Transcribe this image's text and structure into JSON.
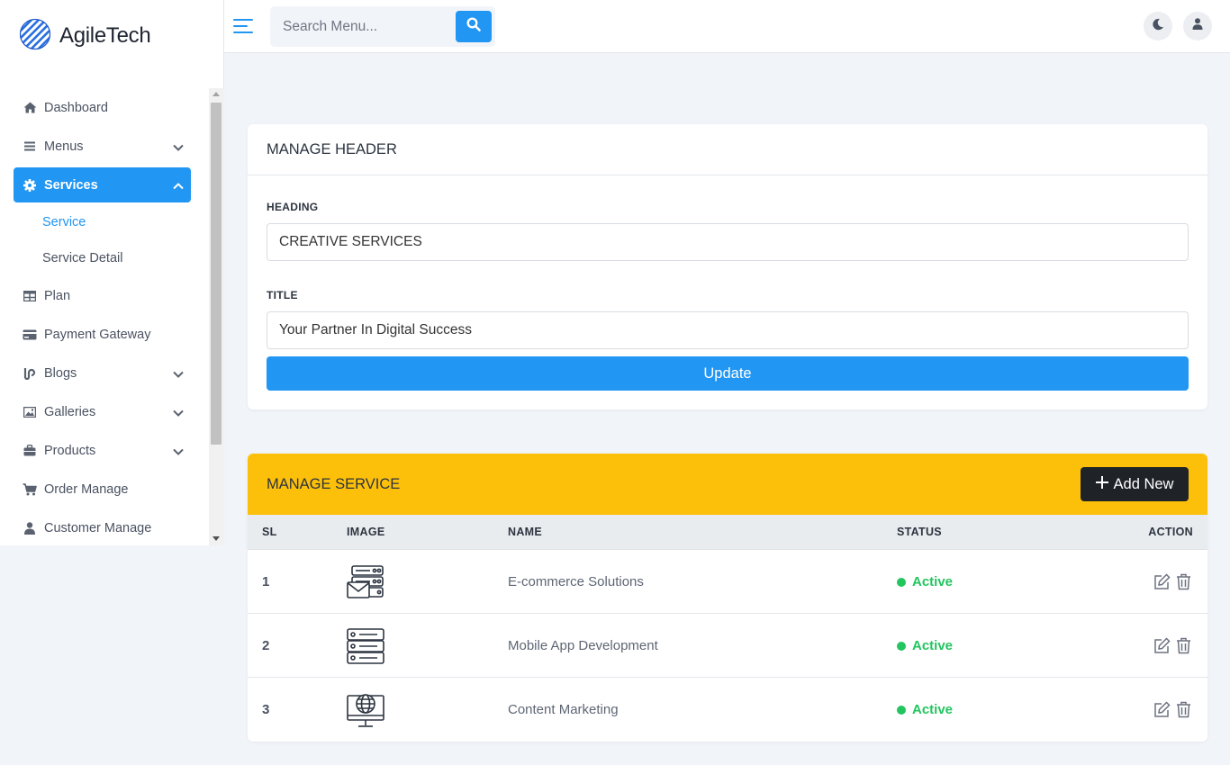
{
  "brand": {
    "name": "AgileTech",
    "logo_icon": "sphere-logo-icon",
    "accent": "#2196f3"
  },
  "sidebar": {
    "items": [
      {
        "label": "Dashboard",
        "icon": "home-icon"
      },
      {
        "label": "Menus",
        "icon": "list-icon",
        "expandable": true
      },
      {
        "label": "Services",
        "icon": "gear-icon",
        "expandable": true,
        "active": true,
        "children": [
          {
            "label": "Service",
            "current": true
          },
          {
            "label": "Service Detail"
          }
        ]
      },
      {
        "label": "Plan",
        "icon": "table-icon"
      },
      {
        "label": "Payment Gateway",
        "icon": "credit-card-icon"
      },
      {
        "label": "Blogs",
        "icon": "blog-icon",
        "expandable": true
      },
      {
        "label": "Galleries",
        "icon": "image-icon",
        "expandable": true
      },
      {
        "label": "Products",
        "icon": "briefcase-icon",
        "expandable": true
      },
      {
        "label": "Order Manage",
        "icon": "cart-icon"
      },
      {
        "label": "Customer Manage",
        "icon": "user-icon"
      }
    ]
  },
  "topbar": {
    "search_placeholder": "Search Menu...",
    "icons": [
      "hamburger-icon",
      "search-icon",
      "moon-icon",
      "user-icon"
    ]
  },
  "header_form": {
    "title": "MANAGE HEADER",
    "heading_label": "HEADING",
    "heading_value": "CREATIVE SERVICES",
    "title_label": "TITLE",
    "title_value": "Your Partner In Digital Success",
    "update_label": "Update"
  },
  "services": {
    "title": "MANAGE SERVICE",
    "add_label": "Add New",
    "header_color": "#fdc00a",
    "columns": [
      "SL",
      "IMAGE",
      "NAME",
      "STATUS",
      "ACTION"
    ],
    "rows": [
      {
        "sl": "1",
        "image": "server-mail-icon",
        "name": "E-commerce Solutions",
        "status": "Active"
      },
      {
        "sl": "2",
        "image": "server-rack-icon",
        "name": "Mobile App Development",
        "status": "Active"
      },
      {
        "sl": "3",
        "image": "globe-monitor-icon",
        "name": "Content Marketing",
        "status": "Active"
      }
    ],
    "status_color": "#22c55e"
  }
}
